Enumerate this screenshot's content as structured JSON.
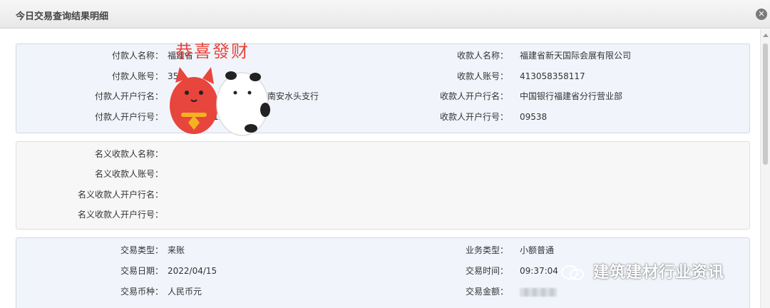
{
  "window": {
    "title": "今日交易查询结果明细",
    "close_symbol": "✕"
  },
  "payer": {
    "name_label": "付款人名称：",
    "name_value": "福建省",
    "account_label": "付款人账号：",
    "account_value": "35",
    "bank_label": "付款人开户行名：",
    "bank_value": "南安水头支行",
    "bank_no_label": "付款人开户行号：",
    "bank_no_value": "12"
  },
  "payee": {
    "name_label": "收款人名称：",
    "name_value": "福建省新天国际会展有限公司",
    "account_label": "收款人账号：",
    "account_value": "413058358117",
    "bank_label": "收款人开户行名：",
    "bank_value": "中国银行福建省分行营业部",
    "bank_no_label": "收款人开户行号：",
    "bank_no_value": "09538"
  },
  "nominal": {
    "name_label": "名义收款人名称：",
    "account_label": "名义收款人账号：",
    "bank_label": "名义收款人开户行名：",
    "bank_no_label": "名义收款人开户行号："
  },
  "transaction": {
    "type_label": "交易类型：",
    "type_value": "来账",
    "date_label": "交易日期：",
    "date_value": "2022/04/15",
    "currency_label": "交易币种：",
    "currency_value": "人民币元",
    "biz_label": "业务类型：",
    "biz_value": "小额普通",
    "time_label": "交易时间：",
    "time_value": "09:37:04",
    "amount_label": "交易金额："
  },
  "sticker": {
    "text": "恭喜發财"
  },
  "watermark": {
    "text": "建筑建材行业资讯"
  }
}
